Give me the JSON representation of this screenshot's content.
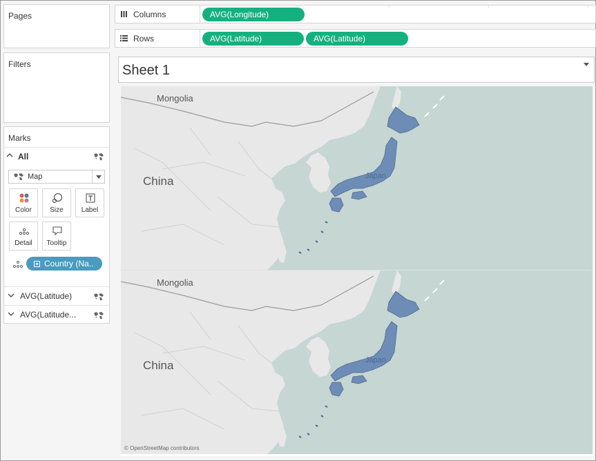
{
  "pages_card": {
    "title": "Pages"
  },
  "filters_card": {
    "title": "Filters"
  },
  "columns_shelf": {
    "label": "Columns",
    "icon": "columns-icon",
    "pills": [
      "AVG(Longitude)"
    ]
  },
  "rows_shelf": {
    "label": "Rows",
    "icon": "rows-icon",
    "pills": [
      "AVG(Latitude)",
      "AVG(Latitude)"
    ]
  },
  "marks_card": {
    "title": "Marks",
    "all_label": "All",
    "mark_type": "Map",
    "buttons": {
      "color": "Color",
      "size": "Size",
      "label": "Label",
      "detail": "Detail",
      "tooltip": "Tooltip"
    },
    "field_pill": "Country (Na..",
    "sections": [
      "AVG(Latitude)",
      "AVG(Latitude..."
    ]
  },
  "sheet": {
    "title": "Sheet 1"
  },
  "map": {
    "labels": {
      "mongolia": "Mongolia",
      "china": "China",
      "japan": "Japan"
    },
    "attribution": "© OpenStreetMap contributors",
    "colors": {
      "land": "#e8e8e8",
      "water": "#c5d6d3",
      "highlight": "#6d8cb6",
      "pill": "#14b17e"
    }
  }
}
